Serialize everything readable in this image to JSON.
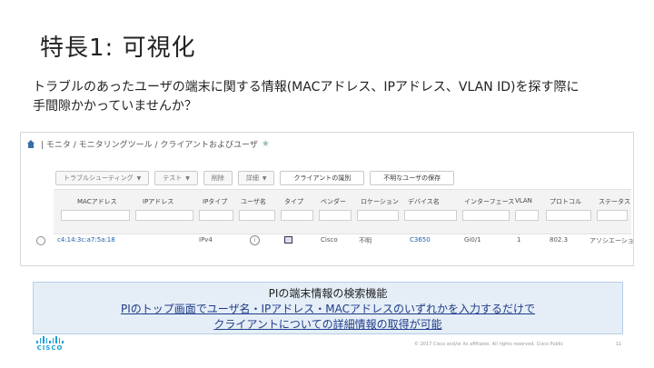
{
  "slide": {
    "title": "特長1: 可視化",
    "lead_line1": "トラブルのあったユーザの端末に関する情報(MACアドレス、IPアドレス、VLAN ID)を探す際に",
    "lead_line2": "手間隙かかっていませんか？"
  },
  "screenshot": {
    "breadcrumb": "| モニタ / モニタリングツール / クライアントおよびユーザ",
    "toolbar": [
      {
        "label": "トラブルシューティング",
        "caret": true
      },
      {
        "label": "テスト",
        "caret": true
      },
      {
        "label": "削除",
        "caret": false
      },
      {
        "label": "詳細",
        "caret": true
      },
      {
        "label": "クライアントの識別",
        "caret": false,
        "wide": true
      },
      {
        "label": "不明なユーザの保存",
        "caret": false,
        "wide": true
      }
    ],
    "columns": [
      "MACアドレス",
      "IPアドレス",
      "IPタイプ",
      "ユーザ名",
      "タイプ",
      "ベンダー",
      "ロケーション",
      "デバイス名",
      "インターフェース",
      "VLAN",
      "プロトコル",
      "ステータス"
    ],
    "row": {
      "mac": "c4:14:3c:a7:5a:18",
      "ip": "",
      "ip_type": "IPv4",
      "user": "",
      "vendor": "Cisco",
      "location": "不明",
      "device": "C3650",
      "interface": "Gi0/1",
      "vlan": "1",
      "protocol": "802.3",
      "status": "アソシエーション"
    }
  },
  "callout": {
    "line1": "PIの端末情報の検索機能",
    "line2": "PIのトップ画面でユーザ名・IPアドレス・MACアドレスのいずれかを入力するだけで",
    "line3": "クライアントについての詳細情報の取得が可能"
  },
  "footer": {
    "logo_text": "CISCO",
    "copyright": "© 2017 Cisco and/or its affiliates. All rights reserved. Cisco Public",
    "page": "11"
  },
  "colors": {
    "accent": "#1ba0d7",
    "link": "#1f3c88",
    "callout_bg": "#e5eef7"
  }
}
